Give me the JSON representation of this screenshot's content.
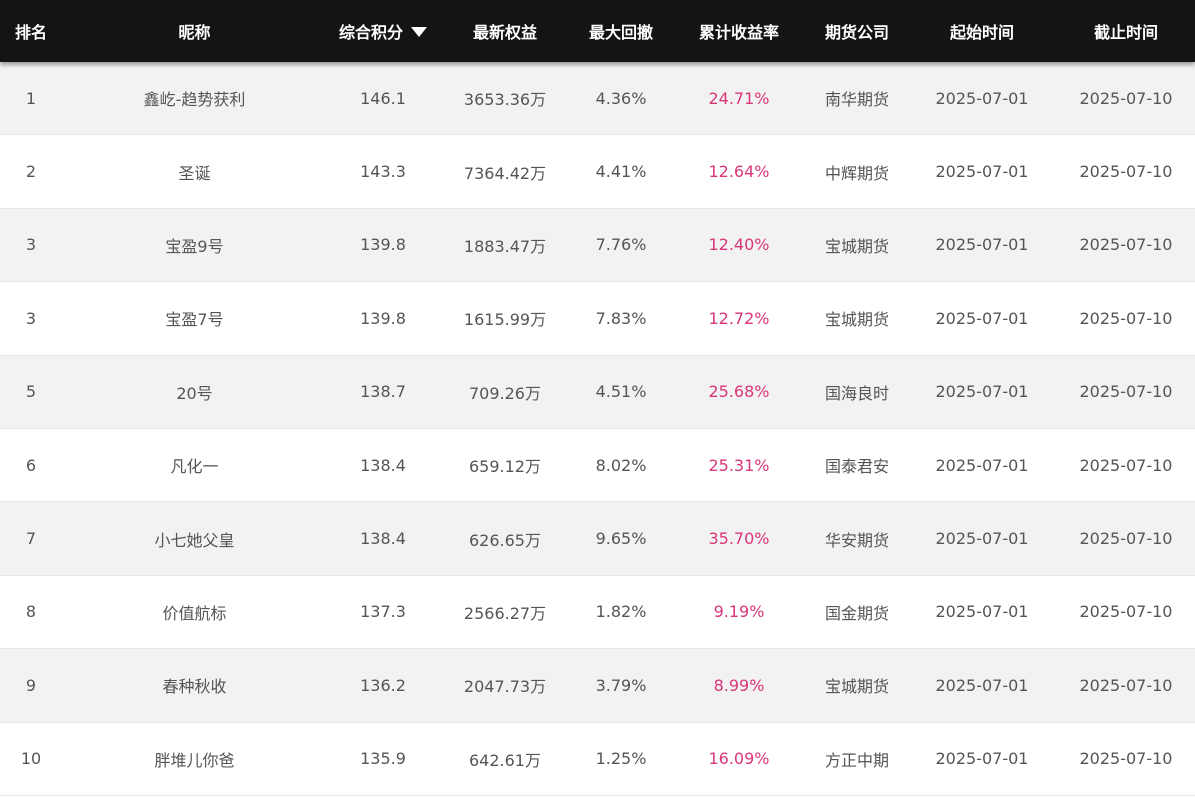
{
  "header": {
    "rank": "排名",
    "name": "昵称",
    "score": "综合积分",
    "equity": "最新权益",
    "drawdown": "最大回撤",
    "return": "累计收益率",
    "broker": "期货公司",
    "start": "起始时间",
    "end": "截止时间"
  },
  "colors": {
    "header_bg": "#141414",
    "row_alt": "#f2f2f2",
    "return_text": "#d9357a"
  },
  "rows": [
    {
      "rank": "1",
      "name": "鑫屹-趋势获利",
      "score": "146.1",
      "equity": "3653.36万",
      "drawdown": "4.36%",
      "return": "24.71%",
      "broker": "南华期货",
      "start": "2025-07-01",
      "end": "2025-07-10"
    },
    {
      "rank": "2",
      "name": "圣诞",
      "score": "143.3",
      "equity": "7364.42万",
      "drawdown": "4.41%",
      "return": "12.64%",
      "broker": "中辉期货",
      "start": "2025-07-01",
      "end": "2025-07-10"
    },
    {
      "rank": "3",
      "name": "宝盈9号",
      "score": "139.8",
      "equity": "1883.47万",
      "drawdown": "7.76%",
      "return": "12.40%",
      "broker": "宝城期货",
      "start": "2025-07-01",
      "end": "2025-07-10"
    },
    {
      "rank": "3",
      "name": "宝盈7号",
      "score": "139.8",
      "equity": "1615.99万",
      "drawdown": "7.83%",
      "return": "12.72%",
      "broker": "宝城期货",
      "start": "2025-07-01",
      "end": "2025-07-10"
    },
    {
      "rank": "5",
      "name": "20号",
      "score": "138.7",
      "equity": "709.26万",
      "drawdown": "4.51%",
      "return": "25.68%",
      "broker": "国海良时",
      "start": "2025-07-01",
      "end": "2025-07-10"
    },
    {
      "rank": "6",
      "name": "凡化一",
      "score": "138.4",
      "equity": "659.12万",
      "drawdown": "8.02%",
      "return": "25.31%",
      "broker": "国泰君安",
      "start": "2025-07-01",
      "end": "2025-07-10"
    },
    {
      "rank": "7",
      "name": "小七她父皇",
      "score": "138.4",
      "equity": "626.65万",
      "drawdown": "9.65%",
      "return": "35.70%",
      "broker": "华安期货",
      "start": "2025-07-01",
      "end": "2025-07-10"
    },
    {
      "rank": "8",
      "name": "价值航标",
      "score": "137.3",
      "equity": "2566.27万",
      "drawdown": "1.82%",
      "return": "9.19%",
      "broker": "国金期货",
      "start": "2025-07-01",
      "end": "2025-07-10"
    },
    {
      "rank": "9",
      "name": "春种秋收",
      "score": "136.2",
      "equity": "2047.73万",
      "drawdown": "3.79%",
      "return": "8.99%",
      "broker": "宝城期货",
      "start": "2025-07-01",
      "end": "2025-07-10"
    },
    {
      "rank": "10",
      "name": "胖堆儿你爸",
      "score": "135.9",
      "equity": "642.61万",
      "drawdown": "1.25%",
      "return": "16.09%",
      "broker": "方正中期",
      "start": "2025-07-01",
      "end": "2025-07-10"
    }
  ]
}
